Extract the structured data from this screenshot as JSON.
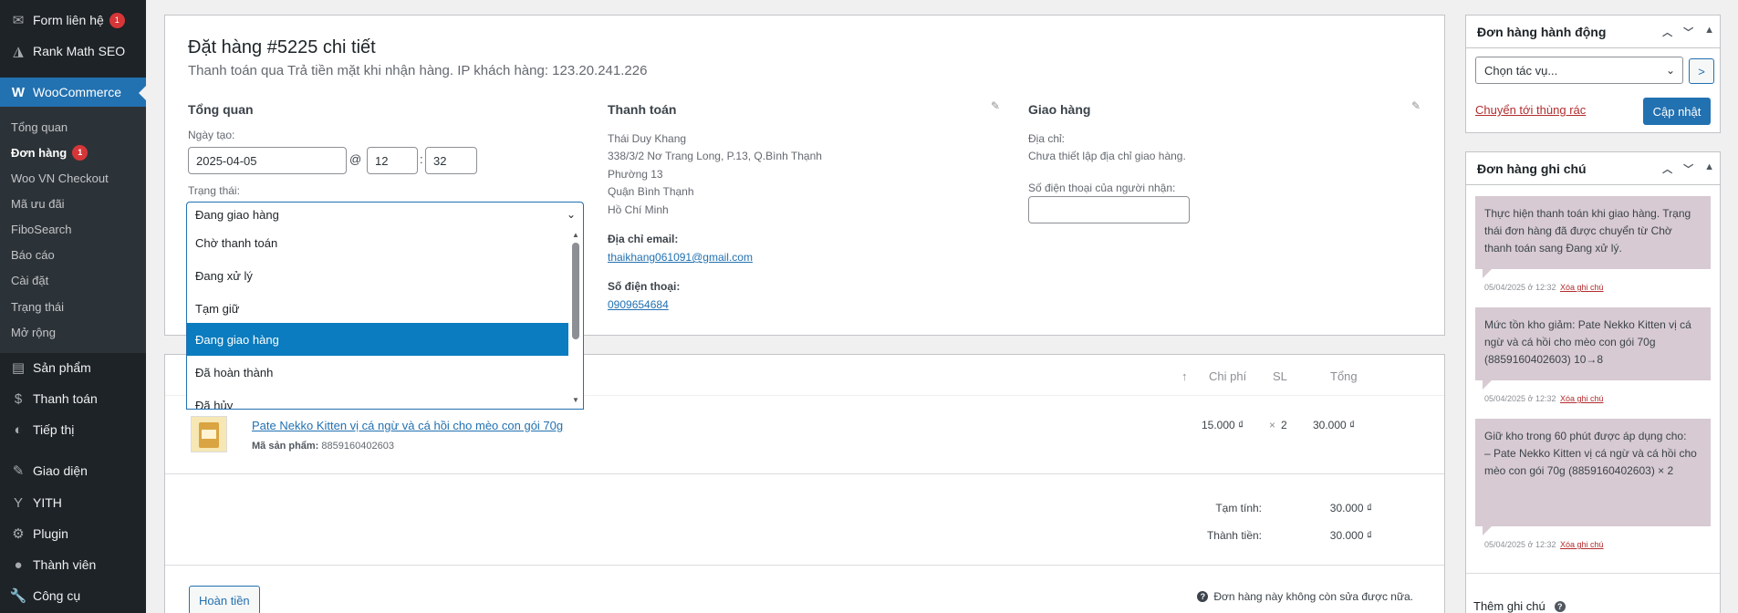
{
  "sidebar": {
    "top_items": [
      {
        "label": "Form liên hệ",
        "icon": "mail-icon",
        "badge": "1"
      },
      {
        "label": "Rank Math SEO",
        "icon": "rankmath-icon"
      }
    ],
    "active": {
      "label": "WooCommerce",
      "icon": "woocommerce-icon"
    },
    "submenu": [
      "Tổng quan",
      "Đơn hàng",
      "Woo VN Checkout",
      "Mã ưu đãi",
      "FiboSearch",
      "Báo cáo",
      "Cài đặt",
      "Trạng thái",
      "Mở rộng"
    ],
    "submenu_badge": "1",
    "bottom_items": [
      {
        "label": "Sản phẩm",
        "icon": "archive-icon"
      },
      {
        "label": "Thanh toán",
        "icon": "payment-icon"
      },
      {
        "label": "Tiếp thị",
        "icon": "megaphone-icon"
      },
      {
        "label": "Giao diện",
        "icon": "paintbrush-icon"
      },
      {
        "label": "YITH",
        "icon": "yith-icon"
      },
      {
        "label": "Plugin",
        "icon": "plugin-icon"
      },
      {
        "label": "Thành viên",
        "icon": "users-icon"
      },
      {
        "label": "Công cụ",
        "icon": "wrench-icon"
      }
    ]
  },
  "order": {
    "title": "Đặt hàng #5225 chi tiết",
    "subtitle": "Thanh toán qua Trả tiền mặt khi nhận hàng. IP khách hàng: 123.20.241.226",
    "general": {
      "heading": "Tổng quan",
      "date_label": "Ngày tạo:",
      "date": "2025-04-05",
      "at": "@",
      "hour": "12",
      "colon": ":",
      "minute": "32",
      "status_label": "Trạng thái:",
      "status_value": "Đang giao hàng",
      "status_options": [
        "Chờ thanh toán",
        "Đang xử lý",
        "Tạm giữ",
        "Đang giao hàng",
        "Đã hoàn thành",
        "Đã hủy"
      ]
    },
    "billing": {
      "heading": "Thanh toán",
      "address_lines": [
        "Thái Duy Khang",
        "338/3/2 Nơ Trang Long, P.13, Q.Bình Thạnh",
        "Phường 13",
        "Quận Bình Thạnh",
        "Hồ Chí Minh"
      ],
      "email_label": "Địa chỉ email:",
      "email": "thaikhang061091@gmail.com",
      "phone_label": "Số điện thoại:",
      "phone": "0909654684"
    },
    "shipping": {
      "heading": "Giao hàng",
      "address_label": "Địa chỉ:",
      "address_value": "Chưa thiết lập địa chỉ giao hàng.",
      "phone_label": "Số điện thoại của người nhận:",
      "phone_value": ""
    }
  },
  "items": {
    "headers": {
      "sort": "↑",
      "cost": "Chi phí",
      "qty": "SL",
      "total": "Tổng"
    },
    "rows": [
      {
        "name": "Pate Nekko Kitten vị cá ngừ và cá hồi cho mèo con gói 70g",
        "sku_label": "Mã sản phẩm:",
        "sku": "8859160402603",
        "cost": "15.000 ₫",
        "qty_prefix": "×",
        "qty": "2",
        "total": "30.000 ₫"
      }
    ],
    "subtotal_label": "Tạm tính:",
    "subtotal": "30.000 ₫",
    "total_label": "Thành tiền:",
    "total": "30.000 ₫",
    "refund_button": "Hoàn tiền",
    "not_editable": "Đơn hàng này không còn sửa được nữa."
  },
  "actions_box": {
    "title": "Đơn hàng hành động",
    "select_value": "Chọn tác vụ...",
    "go": ">",
    "trash_link": "Chuyển tới thùng rác",
    "update_button": "Cập nhật"
  },
  "notes_box": {
    "title": "Đơn hàng ghi chú",
    "notes": [
      {
        "text": "Thực hiện thanh toán khi giao hàng. Trạng thái đơn hàng đã được chuyển từ Chờ thanh toán sang Đang xử lý.",
        "meta": "05/04/2025 ở 12:32",
        "delete": "Xóa ghi chú"
      },
      {
        "text": "Mức tồn kho giảm: Pate Nekko Kitten vị cá ngừ và cá hồi cho mèo con gói 70g (8859160402603) 10→8",
        "meta": "05/04/2025 ở 12:32",
        "delete": "Xóa ghi chú"
      },
      {
        "text": "Giữ kho trong 60 phút được áp dụng cho:\n– Pate Nekko Kitten vị cá ngừ và cá hồi cho mèo con gói 70g (8859160402603) × 2",
        "meta": "05/04/2025 ở 12:32",
        "delete": "Xóa ghi chú"
      }
    ],
    "add_note_label": "Thêm ghi chú"
  }
}
